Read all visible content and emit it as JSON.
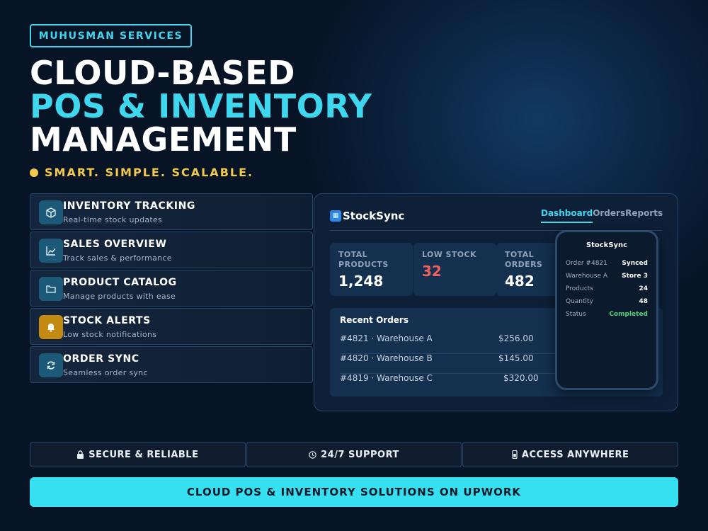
{
  "brand": "MUHUSMAN SERVICES",
  "headline": {
    "line1": "CLOUD-BASED",
    "line2": "POS & INVENTORY",
    "line3": "MANAGEMENT"
  },
  "tagline": "SMART. SIMPLE. SCALABLE.",
  "colors": {
    "accent": "#3fd7ee",
    "gold": "#f2c94c",
    "alert": "#c28a12",
    "red": "#f0605d",
    "green": "#4fd27a",
    "cta": "#37e0f0"
  },
  "features": [
    {
      "icon": "box-icon",
      "title": "INVENTORY TRACKING",
      "subtitle": "Real-time stock updates"
    },
    {
      "icon": "chart-icon",
      "title": "SALES OVERVIEW",
      "subtitle": "Track sales & performance"
    },
    {
      "icon": "folder-icon",
      "title": "PRODUCT CATALOG",
      "subtitle": "Manage products with ease"
    },
    {
      "icon": "bell-icon",
      "title": "STOCK ALERTS",
      "subtitle": "Low stock notifications"
    },
    {
      "icon": "sync-icon",
      "title": "ORDER SYNC",
      "subtitle": "Seamless order sync"
    }
  ],
  "dashboard": {
    "app_name": "StockSync",
    "nav": [
      "Dashboard",
      "Orders",
      "Reports"
    ],
    "stats": [
      {
        "label": "TOTAL PRODUCTS",
        "value": "1,248"
      },
      {
        "label": "LOW STOCK",
        "value": "32"
      },
      {
        "label": "TOTAL ORDERS",
        "value": "482"
      }
    ],
    "recent_orders": {
      "title": "Recent Orders",
      "rows": [
        {
          "id": "#4821 · Warehouse A",
          "amount": "$256.00"
        },
        {
          "id": "#4820 · Warehouse B",
          "amount": "$145.00"
        },
        {
          "id": "#4819 · Warehouse C",
          "amount": "$320.00"
        }
      ]
    },
    "phone": {
      "title": "StockSync",
      "rows": [
        {
          "label": "Order #4821",
          "value": "Synced"
        },
        {
          "label": "Warehouse A",
          "value": "Store 3"
        },
        {
          "label": "Products",
          "value": "24"
        },
        {
          "label": "Quantity",
          "value": "48"
        },
        {
          "label": "Status",
          "value": "Completed"
        }
      ]
    }
  },
  "pills": [
    {
      "icon": "lock-icon",
      "label": "SECURE & RELIABLE"
    },
    {
      "icon": "clock-icon",
      "label": "24/7 SUPPORT"
    },
    {
      "icon": "mobile-icon",
      "label": "ACCESS ANYWHERE"
    }
  ],
  "cta": "CLOUD POS & INVENTORY SOLUTIONS ON UPWORK"
}
